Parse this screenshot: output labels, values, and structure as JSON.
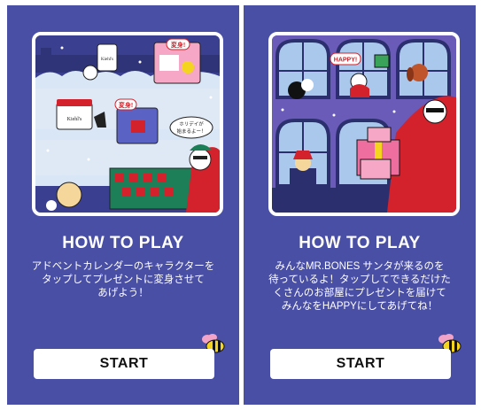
{
  "screens": [
    {
      "title": "HOW TO PLAY",
      "description": [
        "アドベントカレンダーのキャラクターを",
        "タップしてプレゼントに変身させて",
        "あげよう！"
      ],
      "start_label": "START",
      "art_labels": {
        "bubble_1": "変身!",
        "bubble_2": "変身!",
        "bubble_3": "ホリデイが",
        "bubble_3b": "始まるよー！",
        "jar_brand_1": "Kiehl's",
        "jar_brand_2": "Kiehl's"
      }
    },
    {
      "title": "HOW TO PLAY",
      "description": [
        "みんなMR.BONES サンタが来るのを",
        "待っているよ！タップしてできるだけた",
        "くさんのお部屋にプレゼントを届けて",
        "みんなをHAPPYにしてあげてね！"
      ],
      "start_label": "START",
      "art_labels": {
        "bubble": "HAPPY!"
      }
    }
  ],
  "colors": {
    "panel_bg": "#4a4fa6",
    "button_bg": "#ffffff",
    "text": "#ffffff",
    "accent_red": "#d3222b",
    "accent_yellow": "#f5d420",
    "accent_pink": "#ee6f9f"
  },
  "icons": {
    "bee": "bee-icon"
  }
}
